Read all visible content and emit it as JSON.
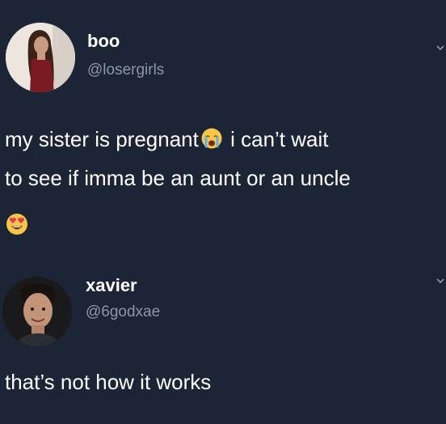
{
  "tweets": [
    {
      "display_name": "boo",
      "handle": "@losergirls",
      "text_part1": "my sister is pregnant",
      "emoji1": "crying-face-emoji",
      "text_part2": "i can’t wait",
      "text_line2": "to see if imma be an aunt or an uncle",
      "emoji2": "heart-eyes-emoji"
    },
    {
      "display_name": "xavier",
      "handle": "@6godxae",
      "text": "that’s not how it works"
    }
  ],
  "colors": {
    "background": "#1c2536",
    "text": "#ffffff",
    "handle": "#8c97a8"
  }
}
